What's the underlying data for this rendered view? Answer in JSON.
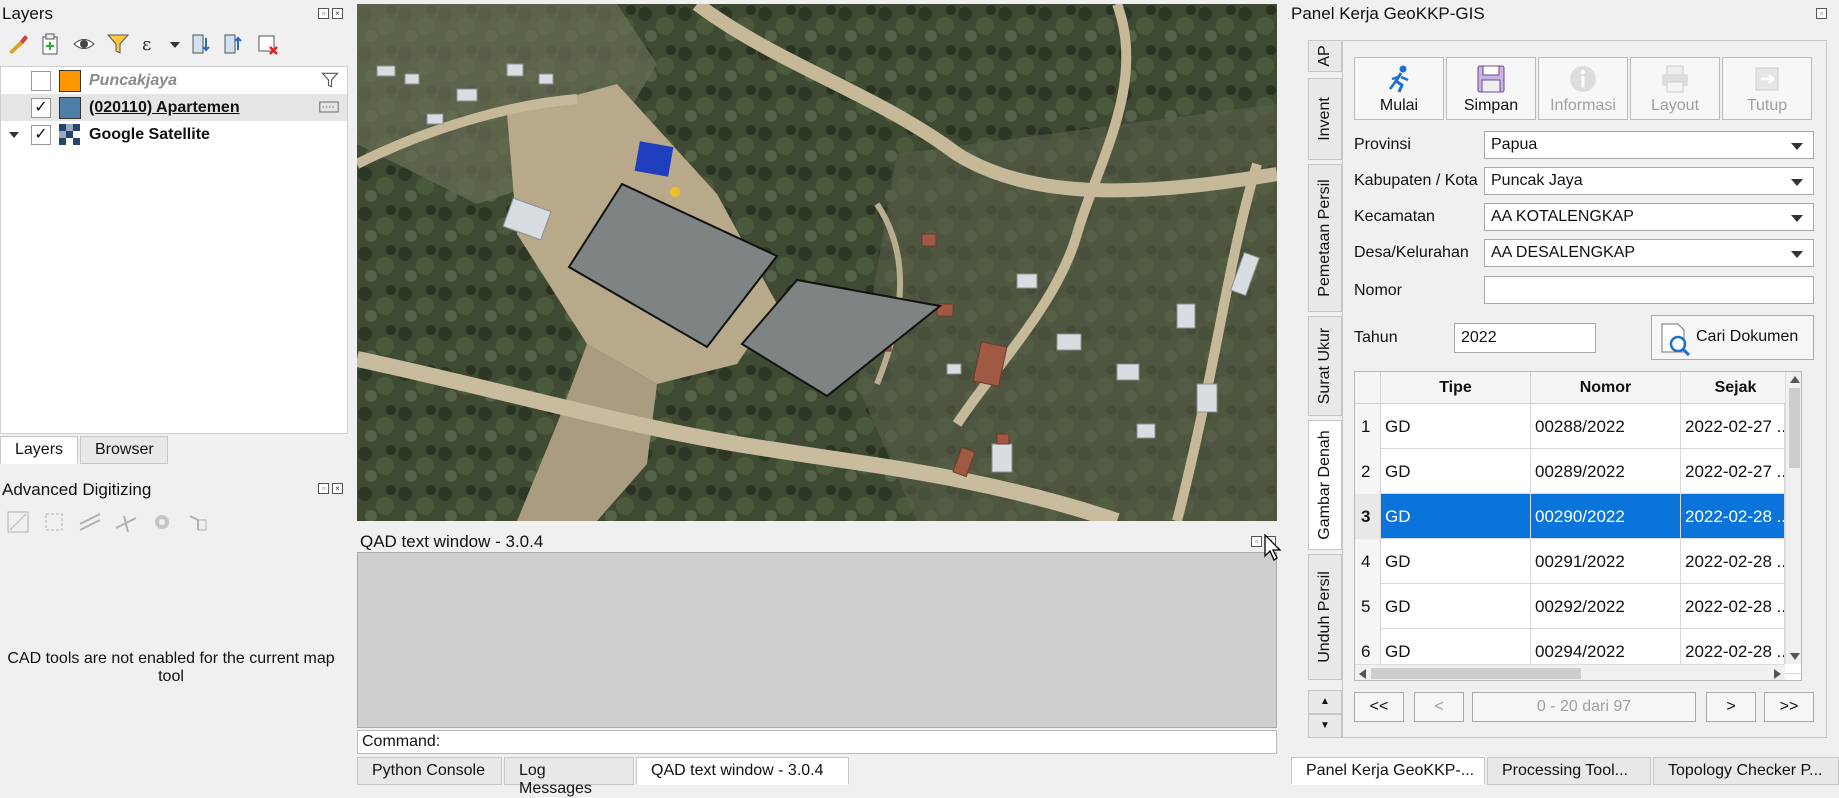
{
  "layers_panel": {
    "title": "Layers",
    "layers": [
      {
        "name": "Puncakjaya",
        "checked": false,
        "color": "#ff9800"
      },
      {
        "name": "(020110) Apartemen",
        "checked": true,
        "color": "#4f7fa8"
      },
      {
        "name": "Google Satellite",
        "checked": true,
        "color": ""
      }
    ],
    "tabs": [
      "Layers",
      "Browser"
    ]
  },
  "advanced_digitizing": {
    "title": "Advanced Digitizing",
    "message": "CAD tools are not enabled for the current map tool"
  },
  "qad_window": {
    "title": "QAD text window - 3.0.4",
    "command_label": "Command:"
  },
  "bottom_tabs": [
    "Python Console",
    "Log Messages",
    "QAD text window - 3.0.4"
  ],
  "right_panel": {
    "title": "Panel Kerja GeoKKP-GIS",
    "side_tabs": [
      "AP",
      "Invent",
      "Pemetaan Persil",
      "Surat Ukur",
      "Gambar Denah",
      "Unduh Persil"
    ],
    "buttons": [
      {
        "label": "Mulai",
        "enabled": true
      },
      {
        "label": "Simpan",
        "enabled": true
      },
      {
        "label": "Informasi",
        "enabled": false
      },
      {
        "label": "Layout",
        "enabled": false
      },
      {
        "label": "Tutup",
        "enabled": false
      }
    ],
    "fields": {
      "provinsi_label": "Provinsi",
      "provinsi": "Papua",
      "kabupaten_label": "Kabupaten / Kota",
      "kabupaten": "Puncak Jaya",
      "kecamatan_label": "Kecamatan",
      "kecamatan": "AA KOTALENGKAP",
      "desa_label": "Desa/Kelurahan",
      "desa": "AA DESALENGKAP",
      "nomor_label": "Nomor",
      "nomor": "",
      "tahun_label": "Tahun",
      "tahun": "2022",
      "cari_label": "Cari Dokumen"
    },
    "table": {
      "headers": [
        "Tipe",
        "Nomor",
        "Sejak"
      ],
      "rows": [
        {
          "num": "1",
          "tipe": "GD",
          "nomor": "00288/2022",
          "sejak": "2022-02-27 ..."
        },
        {
          "num": "2",
          "tipe": "GD",
          "nomor": "00289/2022",
          "sejak": "2022-02-27 ..."
        },
        {
          "num": "3",
          "tipe": "GD",
          "nomor": "00290/2022",
          "sejak": "2022-02-28 ..."
        },
        {
          "num": "4",
          "tipe": "GD",
          "nomor": "00291/2022",
          "sejak": "2022-02-28 ..."
        },
        {
          "num": "5",
          "tipe": "GD",
          "nomor": "00292/2022",
          "sejak": "2022-02-28 ..."
        },
        {
          "num": "6",
          "tipe": "GD",
          "nomor": "00294/2022",
          "sejak": "2022-02-28 ..."
        }
      ],
      "selected_row": 3
    },
    "pager": {
      "first": "<<",
      "prev": "<",
      "info": "0 - 20 dari 97",
      "next": ">",
      "last": ">>"
    },
    "bottom_tabs": [
      "Panel Kerja GeoKKP-...",
      "Processing Tool...",
      "Topology Checker P..."
    ]
  }
}
